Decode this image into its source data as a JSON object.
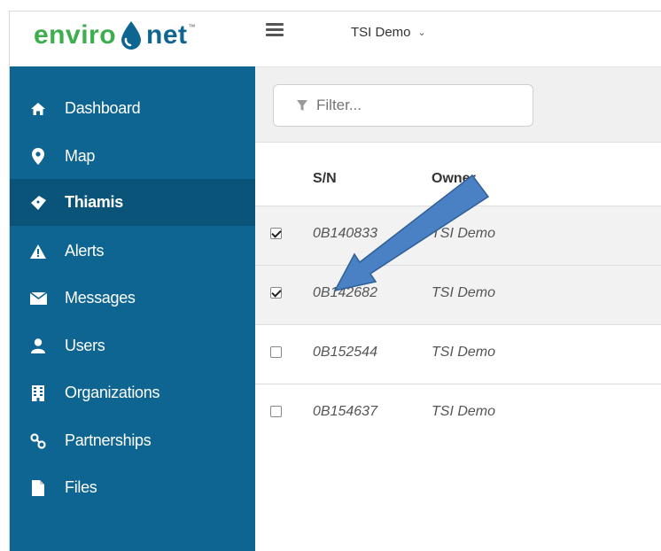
{
  "brand": {
    "part1": "enviro",
    "part2": "net",
    "tm": "™"
  },
  "header": {
    "org_selected": "TSI Demo"
  },
  "sidebar": {
    "items": [
      {
        "label": "Dashboard",
        "icon": "home-icon",
        "active": false
      },
      {
        "label": "Map",
        "icon": "map-pin-icon",
        "active": false
      },
      {
        "label": "Thiamis",
        "icon": "device-icon",
        "active": true
      },
      {
        "label": "Alerts",
        "icon": "warning-icon",
        "active": false
      },
      {
        "label": "Messages",
        "icon": "envelope-icon",
        "active": false
      },
      {
        "label": "Users",
        "icon": "user-icon",
        "active": false
      },
      {
        "label": "Organizations",
        "icon": "building-icon",
        "active": false
      },
      {
        "label": "Partnerships",
        "icon": "link-icon",
        "active": false
      },
      {
        "label": "Files",
        "icon": "file-icon",
        "active": false
      }
    ]
  },
  "filter": {
    "placeholder": "Filter..."
  },
  "table": {
    "headers": [
      "S/N",
      "Owner"
    ],
    "rows": [
      {
        "sn": "0B140833",
        "owner": "TSI Demo",
        "checked": true
      },
      {
        "sn": "0B142682",
        "owner": "TSI Demo",
        "checked": true
      },
      {
        "sn": "0B152544",
        "owner": "TSI Demo",
        "checked": false
      },
      {
        "sn": "0B154637",
        "owner": "TSI Demo",
        "checked": false
      }
    ]
  },
  "colors": {
    "sidebar": "#0f6591",
    "sidebar_active": "#0b5479",
    "brand_green": "#3dae4e",
    "arrow": "#4a80c4"
  }
}
